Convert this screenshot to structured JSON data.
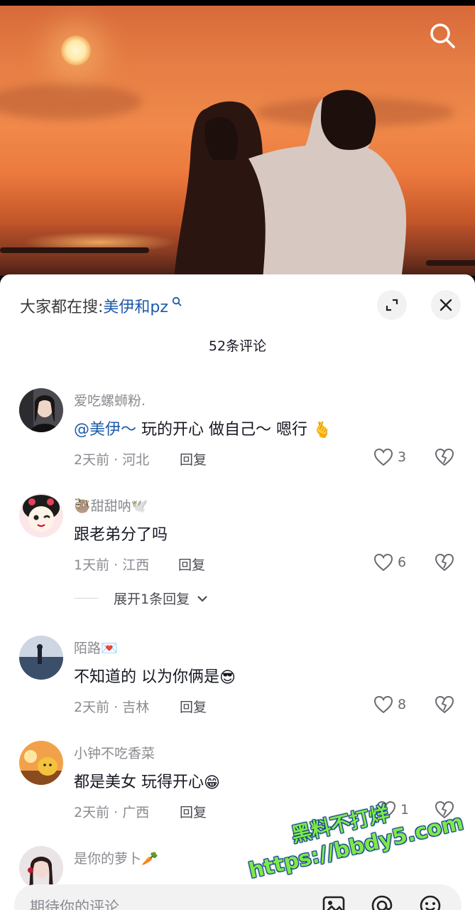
{
  "header": {
    "search_icon": "search-icon"
  },
  "sheet": {
    "suggest_prefix": "大家都在搜:",
    "suggest_keyword": "美伊和pz",
    "comment_count_title": "52条评论"
  },
  "comments": [
    {
      "username": "爱吃螺蛳粉.",
      "mention": "@美伊～",
      "text": " 玩的开心 做自己～ 嗯行",
      "emoji": "🫰",
      "meta": "2天前 · 河北",
      "reply_label": "回复",
      "likes": "3"
    },
    {
      "username_prefix": "🦥",
      "username": "甜甜呐",
      "username_suffix": "🕊️",
      "text": "跟老弟分了吗",
      "meta": "1天前 · 江西",
      "reply_label": "回复",
      "likes": "6",
      "expand_label": "展开1条回复"
    },
    {
      "username": "陌路",
      "username_suffix": "💌",
      "text": "不知道的 以为你俩是",
      "emoji": "😎",
      "meta": "2天前 · 吉林",
      "reply_label": "回复",
      "likes": "8"
    },
    {
      "username": "小钟不吃香菜",
      "text": "都是美女 玩得开心",
      "emoji": "😁",
      "meta": "2天前 · 广西",
      "reply_label": "回复",
      "likes": "1"
    },
    {
      "username": "是你的萝卜",
      "username_suffix": "🥕"
    }
  ],
  "watermark": {
    "line1": "黑料不打烊",
    "line2": "https://bbdy5.com"
  },
  "input": {
    "placeholder": "期待你的评论"
  },
  "colors": {
    "mention": "#1d5aa8",
    "watermark": "#7fe84a"
  }
}
